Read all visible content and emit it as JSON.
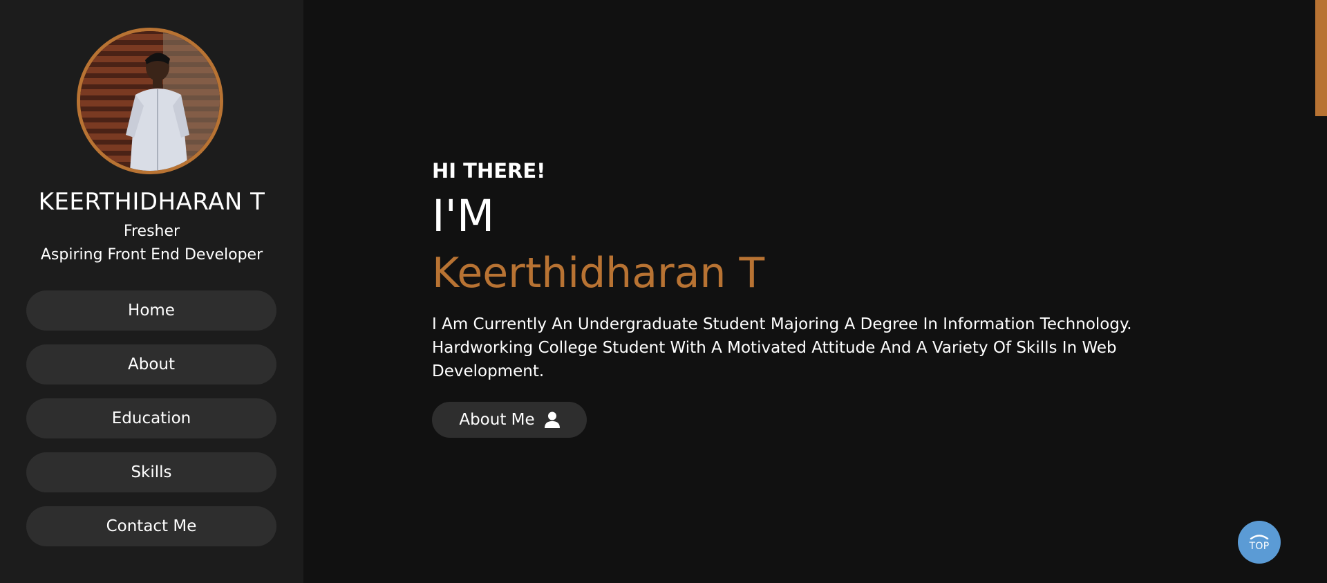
{
  "sidebar": {
    "name": "KEERTHIDHARAN T",
    "role_line1": "Fresher",
    "role_line2": "Aspiring Front End Developer",
    "nav": [
      "Home",
      "About",
      "Education",
      "Skills",
      "Contact Me"
    ]
  },
  "hero": {
    "greeting": "HI THERE!",
    "im": "I'M",
    "name": "Keerthidharan T",
    "description": "I Am Currently An Undergraduate Student Majoring A Degree In Information Technology. Hardworking College Student With A Motivated Attitude And A Variety Of Skills In Web Development.",
    "button_label": "About Me",
    "button_icon": "user-icon"
  },
  "top_button": {
    "label": "TOP",
    "icon": "chevron-up-icon"
  },
  "colors": {
    "accent": "#b87333",
    "background": "#111111",
    "sidebar": "#1c1c1c",
    "nav_button": "#2e2e2e",
    "top_button": "#5b9bd5"
  }
}
